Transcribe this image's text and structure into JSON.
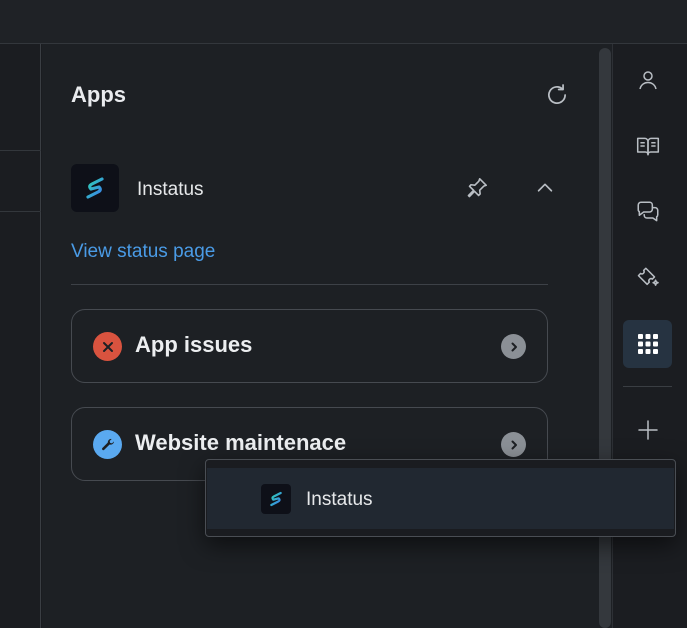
{
  "panel": {
    "title": "Apps",
    "refresh_icon": "refresh-icon"
  },
  "app": {
    "name": "Instatus",
    "logo_icon": "instatus-logo-icon",
    "pin_icon": "pin-icon",
    "collapse_icon": "chevron-up-icon",
    "status_link": "View status page"
  },
  "cards": [
    {
      "label": "App issues",
      "status": "error",
      "status_color": "#d9533f",
      "icon": "close-icon"
    },
    {
      "label": "Website maintenace",
      "status": "maintenance",
      "status_color": "#5aa9f0",
      "icon": "wrench-icon"
    }
  ],
  "menu": {
    "item_label": "Instatus"
  },
  "rail": {
    "items": [
      "user-icon",
      "book-icon",
      "chat-icon",
      "ticket-icon",
      "apps-grid-icon",
      "plus-icon"
    ],
    "active": "apps-grid-icon"
  },
  "colors": {
    "accent_link": "#4a9be6",
    "active_bg": "#263341",
    "logo_gradient_start": "#2fd3b0",
    "logo_gradient_end": "#3a7cf0"
  }
}
